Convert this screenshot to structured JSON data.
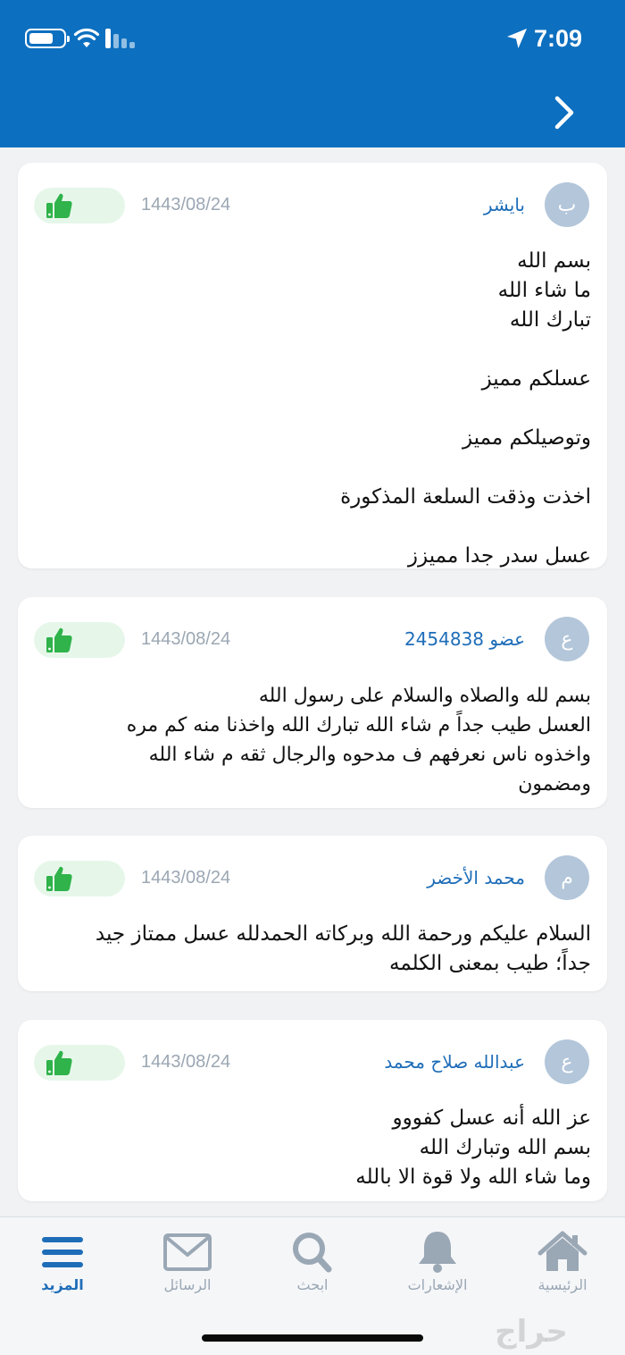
{
  "status_bar": {
    "time": "7:09",
    "icons": [
      "battery-icon",
      "wifi-icon",
      "signal-icon",
      "location-arrow-icon"
    ]
  },
  "header": {
    "background": "#0d6fbf",
    "back_icon": "chevron-right-icon"
  },
  "comments": [
    {
      "avatar": "ب",
      "author": "بايشر",
      "date": "1443/08/24",
      "like_icon": "thumbs-up-icon",
      "text": "بسم الله\nما شاء الله\nتبارك الله\n\nعسلكم مميز\n\nوتوصيلكم مميز\n\nاخذت وذقت السلعة المذكورة\n\nعسل سدر جدا مميزز"
    },
    {
      "avatar": "ع",
      "author": "عضو 2454838",
      "date": "1443/08/24",
      "like_icon": "thumbs-up-icon",
      "text": "بسم لله والصلاه والسلام على رسول الله\nالعسل طيب جداً م شاء الله تبارك الله واخذنا منه كم مره\nواخذوه ناس نعرفهم ف مدحوه والرجال ثقه م شاء الله\nومضمون"
    },
    {
      "avatar": "م",
      "author": "محمد الأخضر",
      "date": "1443/08/24",
      "like_icon": "thumbs-up-icon",
      "text": "السلام عليكم ورحمة الله وبركاته الحمدلله عسل ممتاز جيد\nجداً؛ طيب بمعنى الكلمه"
    },
    {
      "avatar": "ع",
      "author": "عبدالله صلاح محمد",
      "date": "1443/08/24",
      "like_icon": "thumbs-up-icon",
      "text": "عز الله أنه عسل كفووو\nبسم الله وتبارك الله\nوما شاء الله ولا قوة الا بالله"
    }
  ],
  "tabbar": {
    "active_color": "#1e6db8",
    "inactive_color": "#9aa7b5",
    "tabs": [
      {
        "label": "المزيد",
        "icon": "menu-icon",
        "active": true
      },
      {
        "label": "الرسائل",
        "icon": "envelope-icon",
        "active": false
      },
      {
        "label": "ابحث",
        "icon": "search-icon",
        "active": false
      },
      {
        "label": "الإشعارات",
        "icon": "bell-icon",
        "active": false
      },
      {
        "label": "الرئيسية",
        "icon": "home-icon",
        "active": false
      }
    ]
  },
  "watermark": "حراج"
}
